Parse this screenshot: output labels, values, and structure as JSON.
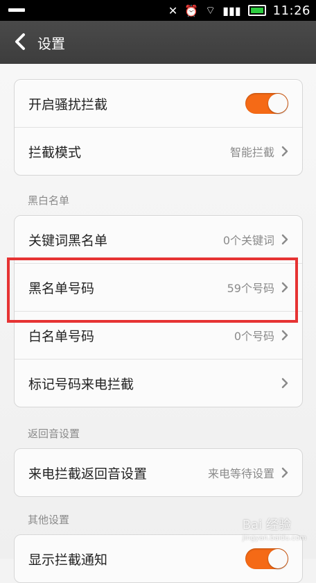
{
  "statusbar": {
    "time": "11:26"
  },
  "header": {
    "title": "设置"
  },
  "section1": {
    "rows": [
      {
        "label": "开启骚扰拦截",
        "toggle": true
      },
      {
        "label": "拦截模式",
        "value": "智能拦截"
      }
    ]
  },
  "section2": {
    "title": "黑白名单",
    "rows": [
      {
        "label": "关键词黑名单",
        "value": "0个关键词"
      },
      {
        "label": "黑名单号码",
        "value": "59个号码"
      },
      {
        "label": "白名单号码",
        "value": "0个号码"
      },
      {
        "label": "标记号码来电拦截",
        "value": ""
      }
    ]
  },
  "section3": {
    "title": "返回音设置",
    "rows": [
      {
        "label": "来电拦截返回音设置",
        "value": "来电等待设置"
      }
    ]
  },
  "section4": {
    "title": "其他设置",
    "rows": [
      {
        "label": "显示拦截通知",
        "toggle": true
      }
    ]
  },
  "watermark": {
    "text": "Bai 经验",
    "sub": "jingyan.baidu.com"
  }
}
